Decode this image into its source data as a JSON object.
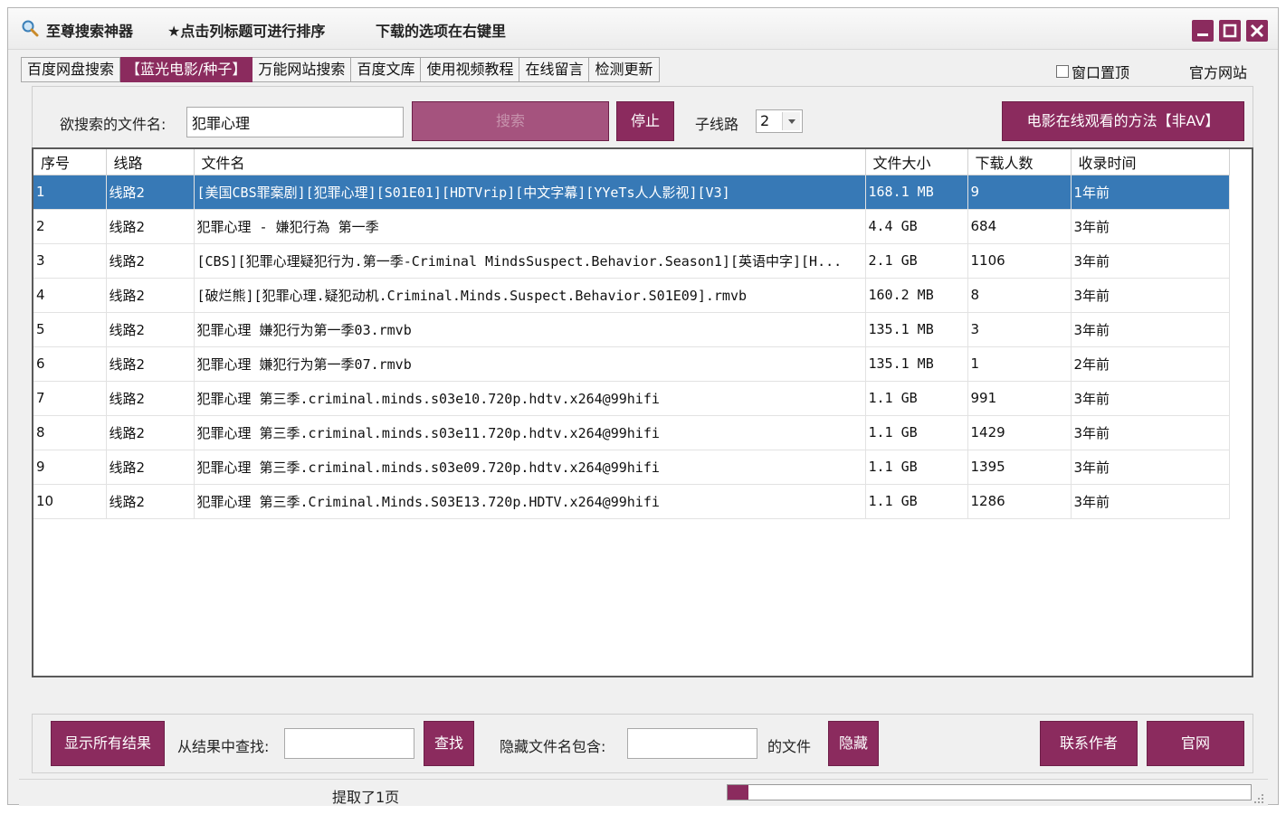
{
  "title_bar": {
    "app_title": "至尊搜索神器",
    "hint_sort": "★点击列标题可进行排序",
    "hint_download": "下载的选项在右键里",
    "icons": [
      "magnifier-app-icon",
      "minimize-icon",
      "maximize-icon",
      "close-icon"
    ]
  },
  "tabs": [
    {
      "label": "百度网盘搜索",
      "active": false
    },
    {
      "label": "【蓝光电影/种子】",
      "active": true
    },
    {
      "label": "万能网站搜索",
      "active": false
    },
    {
      "label": "百度文库",
      "active": false
    },
    {
      "label": "使用视频教程",
      "active": false
    },
    {
      "label": "在线留言",
      "active": false
    },
    {
      "label": "检测更新",
      "active": false
    }
  ],
  "top_right": {
    "pin_label": "窗口置顶",
    "official_site": "官方网站"
  },
  "search": {
    "label": "欲搜索的文件名:",
    "value": "犯罪心理",
    "search_button": "搜索",
    "stop_button": "停止",
    "subline_label": "子线路",
    "subline_value": "2",
    "watch_button": "电影在线观看的方法【非AV】"
  },
  "table": {
    "columns": [
      "序号",
      "线路",
      "文件名",
      "文件大小",
      "下载人数",
      "收录时间"
    ],
    "rows": [
      {
        "no": "1",
        "line": "线路2",
        "name": "[美国CBS罪案剧][犯罪心理][S01E01][HDTVrip][中文字幕][YYeTs人人影视][V3]",
        "size": "168.1  MB",
        "downloads": "9",
        "time": "1年前"
      },
      {
        "no": "2",
        "line": "线路2",
        "name": "犯罪心理 - 嫌犯行為 第一季",
        "size": "4.4  GB",
        "downloads": "684",
        "time": "3年前"
      },
      {
        "no": "3",
        "line": "线路2",
        "name": "[CBS][犯罪心理疑犯行为.第一季-Criminal MindsSuspect.Behavior.Season1][英语中字][H...",
        "size": "2.1  GB",
        "downloads": "1106",
        "time": "3年前"
      },
      {
        "no": "4",
        "line": "线路2",
        "name": "[破烂熊][犯罪心理.疑犯动机.Criminal.Minds.Suspect.Behavior.S01E09].rmvb",
        "size": "160.2  MB",
        "downloads": "8",
        "time": "3年前"
      },
      {
        "no": "5",
        "line": "线路2",
        "name": "犯罪心理 嫌犯行为第一季03.rmvb",
        "size": "135.1  MB",
        "downloads": "3",
        "time": "3年前"
      },
      {
        "no": "6",
        "line": "线路2",
        "name": "犯罪心理 嫌犯行为第一季07.rmvb",
        "size": "135.1  MB",
        "downloads": "1",
        "time": "2年前"
      },
      {
        "no": "7",
        "line": "线路2",
        "name": "犯罪心理 第三季.criminal.minds.s03e10.720p.hdtv.x264@99hifi",
        "size": "1.1  GB",
        "downloads": "991",
        "time": "3年前"
      },
      {
        "no": "8",
        "line": "线路2",
        "name": "犯罪心理 第三季.criminal.minds.s03e11.720p.hdtv.x264@99hifi",
        "size": "1.1  GB",
        "downloads": "1429",
        "time": "3年前"
      },
      {
        "no": "9",
        "line": "线路2",
        "name": "犯罪心理 第三季.criminal.minds.s03e09.720p.hdtv.x264@99hifi",
        "size": "1.1  GB",
        "downloads": "1395",
        "time": "3年前"
      },
      {
        "no": "10",
        "line": "线路2",
        "name": "犯罪心理 第三季.Criminal.Minds.S03E13.720p.HDTV.x264@99hifi",
        "size": "1.1  GB",
        "downloads": "1286",
        "time": "3年前"
      }
    ],
    "selected_row": 0
  },
  "filter": {
    "show_all_button": "显示所有结果",
    "find_label": "从结果中查找:",
    "find_value": "",
    "find_button": "查找",
    "hide_label": "隐藏文件名包含:",
    "hide_value": "",
    "hide_suffix": "的文件",
    "hide_button": "隐藏",
    "contact_button": "联系作者",
    "official_button": "官网"
  },
  "status": {
    "text": "提取了1页",
    "progress": 0.04
  },
  "colors": {
    "accent": "#8b2b5e",
    "selection": "#3779b6"
  }
}
